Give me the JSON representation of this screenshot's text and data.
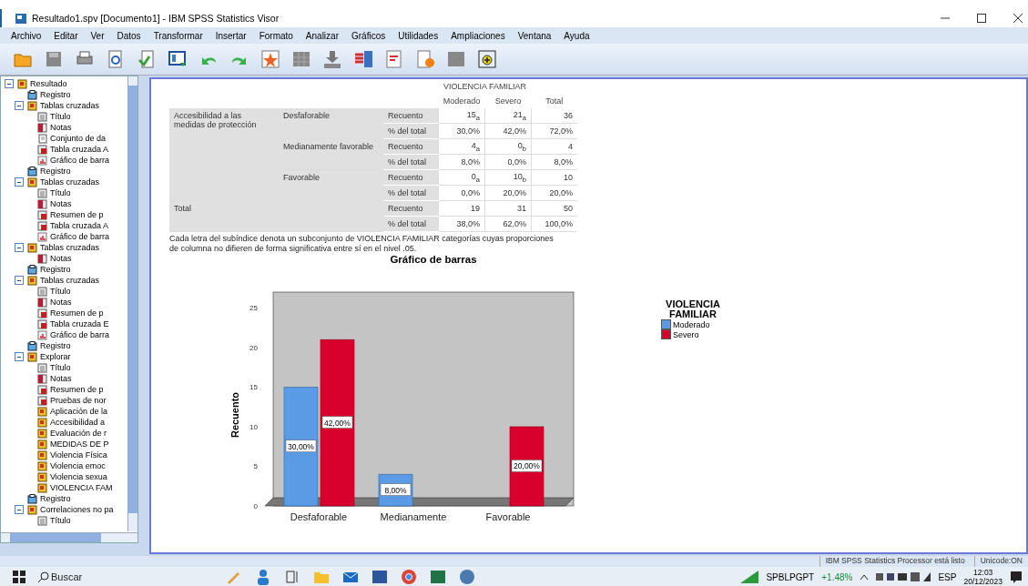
{
  "window": {
    "title": "Resultado1.spv [Documento1] - IBM SPSS Statistics Visor"
  },
  "menu": [
    "Archivo",
    "Editar",
    "Ver",
    "Datos",
    "Transformar",
    "Insertar",
    "Formato",
    "Analizar",
    "Gráficos",
    "Utilidades",
    "Ampliaciones",
    "Ventana",
    "Ayuda"
  ],
  "outline": [
    {
      "label": "Resultado",
      "kind": "folder",
      "expanded": true,
      "children": [
        {
          "label": "Registro",
          "kind": "log"
        },
        {
          "label": "Tablas cruzadas",
          "kind": "folder",
          "expanded": true,
          "children": [
            {
              "label": "Título",
              "kind": "title"
            },
            {
              "label": "Notas",
              "kind": "notes"
            },
            {
              "label": "Conjunto de da",
              "kind": "dataset"
            },
            {
              "label": "Tabla cruzada A",
              "kind": "table"
            },
            {
              "label": "Gráfico de barra",
              "kind": "chart"
            }
          ]
        },
        {
          "label": "Registro",
          "kind": "log"
        },
        {
          "label": "Tablas cruzadas",
          "kind": "folder",
          "expanded": true,
          "children": [
            {
              "label": "Título",
              "kind": "title"
            },
            {
              "label": "Notas",
              "kind": "notes"
            },
            {
              "label": "Resumen de p",
              "kind": "table"
            },
            {
              "label": "Tabla cruzada A",
              "kind": "table"
            },
            {
              "label": "Gráfico de barra",
              "kind": "chart"
            }
          ]
        },
        {
          "label": "Tablas cruzadas",
          "kind": "folder",
          "expanded": true,
          "children": [
            {
              "label": "Notas",
              "kind": "notes"
            }
          ]
        },
        {
          "label": "Registro",
          "kind": "log"
        },
        {
          "label": "Tablas cruzadas",
          "kind": "folder",
          "expanded": true,
          "children": [
            {
              "label": "Título",
              "kind": "title"
            },
            {
              "label": "Notas",
              "kind": "notes"
            },
            {
              "label": "Resumen de p",
              "kind": "table"
            },
            {
              "label": "Tabla cruzada E",
              "kind": "table"
            },
            {
              "label": "Gráfico de barra",
              "kind": "chart"
            }
          ]
        },
        {
          "label": "Registro",
          "kind": "log"
        },
        {
          "label": "Explorar",
          "kind": "folder",
          "expanded": true,
          "children": [
            {
              "label": "Título",
              "kind": "title"
            },
            {
              "label": "Notas",
              "kind": "notes"
            },
            {
              "label": "Resumen de p",
              "kind": "table"
            },
            {
              "label": "Pruebas de nor",
              "kind": "table"
            },
            {
              "label": "Aplicación de la",
              "kind": "folder"
            },
            {
              "label": "Accesibilidad a",
              "kind": "folder"
            },
            {
              "label": "Evaluación de r",
              "kind": "folder"
            },
            {
              "label": "MEDIDAS DE P",
              "kind": "folder"
            },
            {
              "label": "Violencia Física",
              "kind": "folder"
            },
            {
              "label": "Violencia emoc",
              "kind": "folder"
            },
            {
              "label": "Violencia sexua",
              "kind": "folder"
            },
            {
              "label": "VIOLENCIA FAM",
              "kind": "folder"
            }
          ]
        },
        {
          "label": "Registro",
          "kind": "log"
        },
        {
          "label": "Correlaciones no pa",
          "kind": "folder",
          "expanded": true,
          "children": [
            {
              "label": "Título",
              "kind": "title"
            }
          ]
        }
      ]
    }
  ],
  "table": {
    "column_group": "VIOLENCIA FAMILIAR",
    "columns": [
      "Moderado",
      "Severo",
      "Total"
    ],
    "row_variable": "Accesibilidad a las medidas de protección",
    "groups": [
      {
        "label": "Desfaforable",
        "rows": [
          {
            "statistic": "Recuento",
            "cells": [
              "15$_{a}$",
              "21$_{a}$",
              "36"
            ]
          },
          {
            "statistic": "% del total",
            "cells": [
              "30,0%",
              "42,0%",
              "72,0%"
            ]
          }
        ]
      },
      {
        "label": "Medianamente favorable",
        "rows": [
          {
            "statistic": "Recuento",
            "cells": [
              "4$_{a}$",
              "0$_{b}$",
              "4"
            ]
          },
          {
            "statistic": "% del total",
            "cells": [
              "8,0%",
              "0,0%",
              "8,0%"
            ]
          }
        ]
      },
      {
        "label": "Favorable",
        "rows": [
          {
            "statistic": "Recuento",
            "cells": [
              "0$_{a}$",
              "10$_{b}$",
              "10"
            ]
          },
          {
            "statistic": "% del total",
            "cells": [
              "0,0%",
              "20,0%",
              "20,0%"
            ]
          }
        ]
      }
    ],
    "total": {
      "label": "Total",
      "rows": [
        {
          "statistic": "Recuento",
          "cells": [
            "19",
            "31",
            "50"
          ]
        },
        {
          "statistic": "% del total",
          "cells": [
            "38,0%",
            "62,0%",
            "100,0%"
          ]
        }
      ]
    },
    "footnote": "Cada letra del subíndice denota un subconjunto de VIOLENCIA FAMILIAR categorías cuyas proporciones de columna no difieren de forma significativa entre sí en el nivel .05."
  },
  "chart": {
    "chart_data": {
      "type": "bar",
      "title": "Gráfico de barras",
      "legend": {
        "title": "VIOLENCIA FAMILIAR"
      },
      "ylabel": "Recuento",
      "categories": [
        "Desfaforable",
        "Medianamente",
        "Favorable"
      ],
      "series": [
        {
          "name": "Moderado",
          "color": "#5b9be6",
          "values": [
            15,
            4,
            0
          ]
        },
        {
          "name": "Severo",
          "color": "#d8002c",
          "values": [
            21,
            0,
            10
          ]
        }
      ],
      "ylim": [
        0,
        27
      ],
      "yticks": [
        0,
        5,
        10,
        15,
        20,
        25
      ],
      "value_labels": [
        [
          "30,00%",
          "8,00%",
          null
        ],
        [
          "42,00%",
          null,
          "20,00%"
        ]
      ]
    }
  },
  "status_bar": [
    "IBM SPSS Statistics Processor está listo",
    "Unicode:ON"
  ],
  "taskbar": {
    "search": {
      "placeholder": "Buscar"
    },
    "stock": {
      "symbol": "SPBLPGPT",
      "change": "+1.48%"
    },
    "language": "ESP",
    "time": "12:03",
    "date": "20/12/2023"
  }
}
